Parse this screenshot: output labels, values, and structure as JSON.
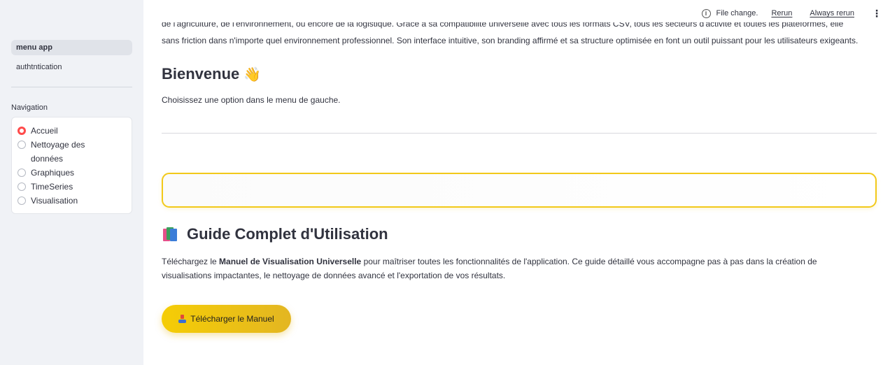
{
  "header": {
    "status_text": "File change.",
    "rerun_label": "Rerun",
    "always_rerun_label": "Always rerun",
    "more_icon": "kebab-vertical-icon"
  },
  "sidebar": {
    "pages": [
      {
        "label": "menu app",
        "active": true
      },
      {
        "label": "authtntication",
        "active": false
      }
    ],
    "navigation_label": "Navigation",
    "radio_options": [
      {
        "label": "Accueil",
        "checked": true
      },
      {
        "label": "Nettoyage des données",
        "checked": false
      },
      {
        "label": "Graphiques",
        "checked": false
      },
      {
        "label": "TimeSeries",
        "checked": false
      },
      {
        "label": "Visualisation",
        "checked": false
      }
    ]
  },
  "main": {
    "clipped_line": "de l'agriculture, de l'environnement, ou encore de la logistique. Grâce à sa compatibilité universelle avec tous les formats CSV, tous les secteurs d'activité et toutes les plateformes, elle s'intègre",
    "intro_paragraph": "sans friction dans n'importe quel environnement professionnel. Son interface intuitive, son branding affirmé et sa structure optimisée en font un outil puissant pour les utilisateurs exigeants.",
    "welcome_title": "Bienvenue",
    "welcome_emoji": "👋",
    "choose_text": "Choisissez une option dans le menu de gauche.",
    "guide_title": "Guide Complet d'Utilisation",
    "guide_text_pre": "Téléchargez le ",
    "guide_text_bold": "Manuel de Visualisation Universelle",
    "guide_text_post": " pour maîtriser toutes les fonctionnalités de l'application. Ce guide détaillé vous accompagne pas à pas dans la création de visualisations impactantes, le nettoyage de données avancé et l'exportation de vos résultats.",
    "download_label": "Télécharger le Manuel"
  },
  "colors": {
    "accent_red": "#ff4b4b",
    "yellow": "#f2c91a",
    "sidebar_bg": "#f0f2f6"
  }
}
